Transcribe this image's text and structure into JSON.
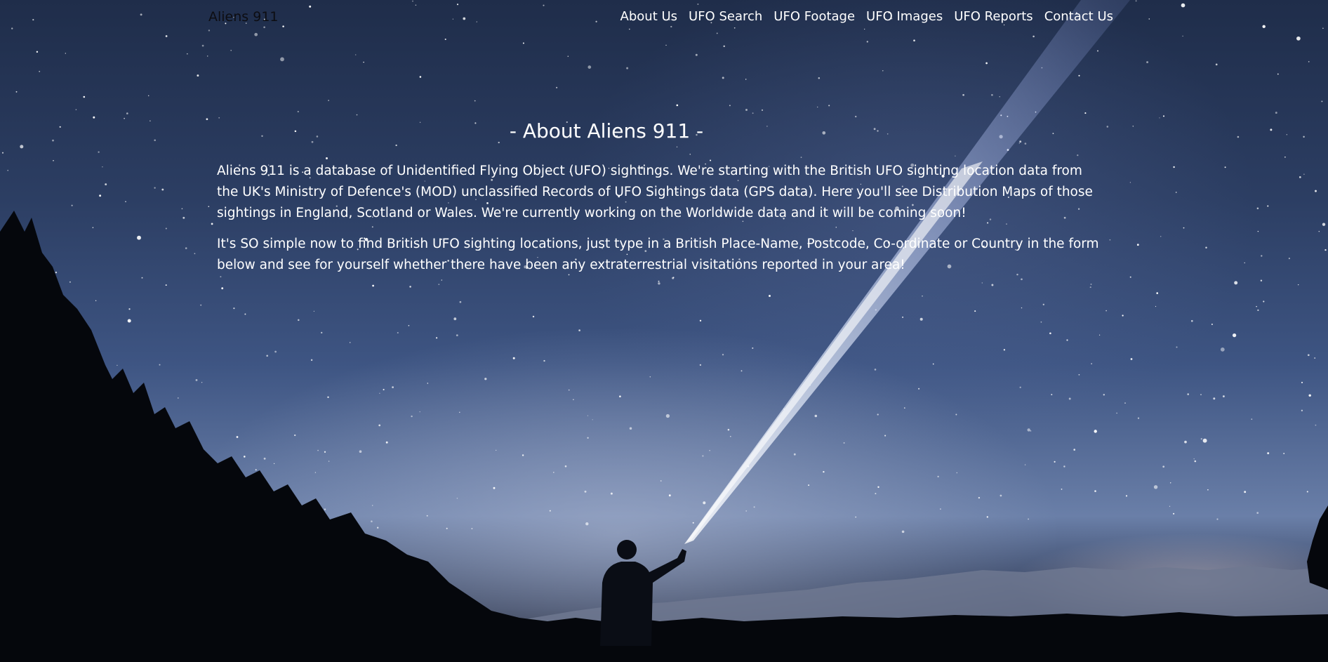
{
  "navbar": {
    "brand": "Aliens 911",
    "links": [
      {
        "label": "About Us"
      },
      {
        "label": "UFO Search"
      },
      {
        "label": "UFO Footage"
      },
      {
        "label": "UFO Images"
      },
      {
        "label": "UFO Reports"
      },
      {
        "label": "Contact Us"
      }
    ]
  },
  "about": {
    "heading": "- About Aliens 911 -",
    "paragraphs": [
      "Aliens 911 is a database of Unidentified Flying Object (UFO) sightings. We're starting with the British UFO sighting location data from the UK's Ministry of Defence's (MOD) unclassified Records of UFO Sightings data (GPS data). Here you'll see Distribution Maps of those sightings in England, Scotland or Wales. We're currently working on the Worldwide data and it will be coming soon!",
      "It's SO simple now to find British UFO sighting locations, just type in a British Place-Name, Postcode, Co-ordinate or Country in the form below and see for yourself whether there have been any extraterrestrial visitations reported in your area!"
    ]
  },
  "colors": {
    "sky_top": "#1f2d4a",
    "sky_mid": "#3e5583",
    "ground": "#05070c",
    "text": "#ffffff",
    "brand_text": "#0d0d12"
  },
  "background": {
    "description_icon": "night-sky-flashlight-image"
  }
}
